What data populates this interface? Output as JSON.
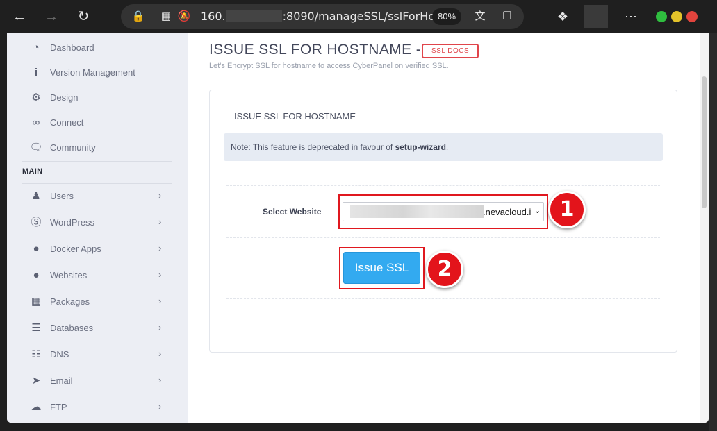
{
  "browser": {
    "url_prefix": "160.",
    "url_suffix": ":8090/manageSSL/sslForHo",
    "zoom": "80%",
    "back_icon": "arrow-left-icon",
    "forward_icon": "arrow-right-icon",
    "reload_icon": "reload-icon"
  },
  "sidebar": {
    "items_top": [
      {
        "label": "Dashboard",
        "icon": "dashboard-icon"
      },
      {
        "label": "Version Management",
        "icon": "info-icon"
      },
      {
        "label": "Design",
        "icon": "gear-icon"
      },
      {
        "label": "Connect",
        "icon": "link-icon"
      },
      {
        "label": "Community",
        "icon": "chat-icon"
      }
    ],
    "section_heading": "MAIN",
    "items_main": [
      {
        "label": "Users",
        "icon": "users-icon"
      },
      {
        "label": "WordPress",
        "icon": "wordpress-icon"
      },
      {
        "label": "Docker Apps",
        "icon": "globe-icon"
      },
      {
        "label": "Websites",
        "icon": "globe-icon"
      },
      {
        "label": "Packages",
        "icon": "cubes-icon"
      },
      {
        "label": "Databases",
        "icon": "database-icon"
      },
      {
        "label": "DNS",
        "icon": "sitemap-icon"
      },
      {
        "label": "Email",
        "icon": "paper-plane-icon"
      },
      {
        "label": "FTP",
        "icon": "cloud-upload-icon"
      }
    ]
  },
  "main": {
    "title": "ISSUE SSL FOR HOSTNAME -",
    "docs_badge": "SSL DOCS",
    "subtitle": "Let's Encrypt SSL for hostname to access CyberPanel on verified SSL.",
    "card_title": "ISSUE SSL FOR HOSTNAME",
    "note_prefix": "Note: This feature is deprecated in favour of ",
    "note_link": "setup-wizard",
    "note_suffix": ".",
    "select_label": "Select Website",
    "select_value_visible": ".nevacloud.i",
    "button_label": "Issue SSL",
    "step_1": "1",
    "step_2": "2"
  }
}
